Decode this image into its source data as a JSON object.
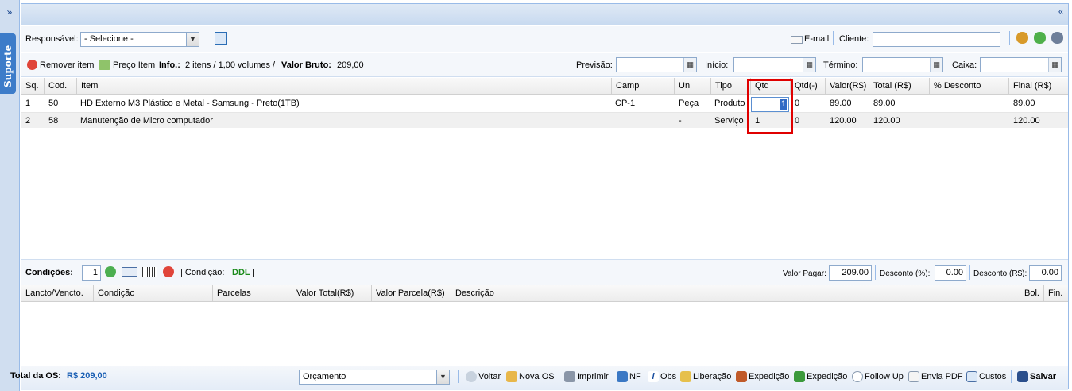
{
  "side": {
    "expand_icon": "»",
    "suporte_label": "Suporte"
  },
  "topbar": {
    "collapse_icon": "«"
  },
  "header": {
    "responsavel_label": "Responsável:",
    "responsavel_value": "- Selecione -",
    "email_label": "E-mail",
    "cliente_label": "Cliente:"
  },
  "info_bar": {
    "remove_label": "Remover item",
    "price_label": "Preço Item",
    "info_label": "Info.:",
    "info_text": "2 itens / 1,00 volumes /",
    "bruto_label": "Valor Bruto:",
    "bruto_value": "209,00",
    "previsao_label": "Previsão:",
    "inicio_label": "Início:",
    "termino_label": "Término:",
    "caixa_label": "Caixa:"
  },
  "items_table": {
    "columns": [
      "Sq.",
      "Cod.",
      "Item",
      "Camp",
      "Un",
      "Tipo",
      "Qtd",
      "Qtd(-)",
      "Valor(R$)",
      "Total (R$)",
      "% Desconto",
      "Final (R$)"
    ],
    "rows": [
      {
        "sq": "1",
        "cod": "50",
        "item": "HD Externo M3 Plástico e Metal - Samsung - Preto(1TB)",
        "camp": "CP-1",
        "un": "Peça",
        "tipo": "Produto",
        "qtd": "1",
        "qtd_minus": "0",
        "valor": "89.00",
        "total": "89.00",
        "desconto": "",
        "final": "89.00"
      },
      {
        "sq": "2",
        "cod": "58",
        "item": "Manutenção de Micro computador",
        "camp": "",
        "un": "-",
        "tipo": "Serviço",
        "qtd": "1",
        "qtd_minus": "0",
        "valor": "120.00",
        "total": "120.00",
        "desconto": "",
        "final": "120.00"
      }
    ]
  },
  "conditions": {
    "label": "Condições:",
    "count": "1",
    "condicao_label": "| Condição:",
    "condicao_value": "DDL",
    "condicao_end": "|",
    "valor_pagar_label": "Valor Pagar:",
    "valor_pagar_value": "209.00",
    "desconto_pct_label": "Desconto (%):",
    "desconto_pct_value": "0.00",
    "desconto_rs_label": "Desconto (R$):",
    "desconto_rs_value": "0.00"
  },
  "payments_table": {
    "columns": [
      "Lancto/Vencto.",
      "Condição",
      "Parcelas",
      "Valor Total(R$)",
      "Valor Parcela(R$)",
      "Descrição",
      "Bol.",
      "Fin."
    ]
  },
  "footer": {
    "total_label": "Total da OS:",
    "total_value": "R$ 209,00",
    "status_value": "Orçamento",
    "buttons": [
      "Voltar",
      "Nova OS",
      "Imprimir",
      "NF",
      "Obs",
      "Liberação",
      "Expedição",
      "Expedição",
      "Follow Up",
      "Envia PDF",
      "Custos",
      "Salvar"
    ]
  },
  "colors": {
    "accent": "#15428b",
    "border": "#99bbe8",
    "highlight": "#e00000",
    "ddl": "#1a8a1a"
  }
}
